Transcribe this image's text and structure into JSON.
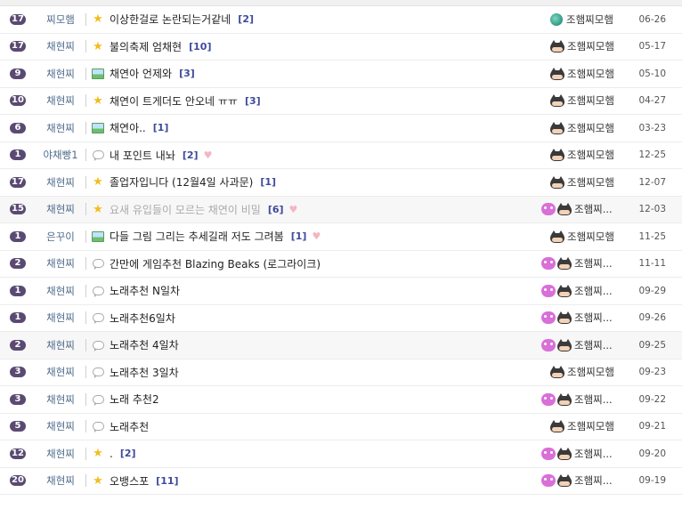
{
  "rows": [
    {
      "comments": "17",
      "category": "찌모햄",
      "icon": "star-icon",
      "title": "이상한걸로 논란되는거같네",
      "count": "[2]",
      "heart": false,
      "muted": false,
      "avatars": [
        "globe-avatar-icon"
      ],
      "author": "조햄찌모햄",
      "date": "06-26"
    },
    {
      "comments": "17",
      "category": "채현찌",
      "icon": "star-icon",
      "title": "불의축제 엄채현",
      "count": "[10]",
      "heart": false,
      "muted": false,
      "avatars": [
        "cat-avatar-icon"
      ],
      "author": "조햄찌모햄",
      "date": "05-17"
    },
    {
      "comments": "9",
      "category": "채현찌",
      "icon": "image-icon",
      "title": "채연아 언제와",
      "count": "[3]",
      "heart": false,
      "muted": false,
      "avatars": [
        "cat-avatar-icon"
      ],
      "author": "조햄찌모햄",
      "date": "05-10"
    },
    {
      "comments": "10",
      "category": "채현찌",
      "icon": "star-icon",
      "title": "채연이 트게더도 안오네 ㅠㅠ",
      "count": "[3]",
      "heart": false,
      "muted": false,
      "avatars": [
        "cat-avatar-icon"
      ],
      "author": "조햄찌모햄",
      "date": "04-27"
    },
    {
      "comments": "6",
      "category": "채현찌",
      "icon": "image-icon",
      "title": "채연아..",
      "count": "[1]",
      "heart": false,
      "muted": false,
      "avatars": [
        "cat-avatar-icon"
      ],
      "author": "조햄찌모햄",
      "date": "03-23"
    },
    {
      "comments": "1",
      "category": "야채빵1",
      "icon": "speech-bubble-icon",
      "title": "내 포인트 내놔",
      "count": "[2]",
      "heart": true,
      "muted": false,
      "avatars": [
        "cat-avatar-icon"
      ],
      "author": "조햄찌모햄",
      "date": "12-25"
    },
    {
      "comments": "17",
      "category": "채현찌",
      "icon": "star-icon",
      "title": "졸업자입니다 (12월4일 사과문)",
      "count": "[1]",
      "heart": false,
      "muted": false,
      "avatars": [
        "cat-avatar-icon"
      ],
      "author": "조햄찌모햄",
      "date": "12-07"
    },
    {
      "comments": "15",
      "category": "채현찌",
      "icon": "star-icon",
      "title": "요새 유입들이 모르는 채연이 비밀",
      "count": "[6]",
      "heart": true,
      "muted": true,
      "avatars": [
        "pink-avatar-icon",
        "cat-avatar-icon"
      ],
      "author": "조햄찌...",
      "date": "12-03"
    },
    {
      "comments": "1",
      "category": "은꾸이",
      "icon": "image-icon",
      "title": "다들 그림 그리는 추세길래 저도 그려봄",
      "count": "[1]",
      "heart": true,
      "muted": false,
      "avatars": [
        "cat-avatar-icon"
      ],
      "author": "조햄찌모햄",
      "date": "11-25"
    },
    {
      "comments": "2",
      "category": "채현찌",
      "icon": "speech-bubble-icon",
      "title": "간만에 게임추천 Blazing Beaks (로그라이크)",
      "count": "",
      "heart": false,
      "muted": false,
      "avatars": [
        "pink-avatar-icon",
        "cat-avatar-icon"
      ],
      "author": "조햄찌...",
      "date": "11-11"
    },
    {
      "comments": "1",
      "category": "채현찌",
      "icon": "speech-bubble-icon",
      "title": "노래추천 N일차",
      "count": "",
      "heart": false,
      "muted": false,
      "avatars": [
        "pink-avatar-icon",
        "cat-avatar-icon"
      ],
      "author": "조햄찌...",
      "date": "09-29"
    },
    {
      "comments": "1",
      "category": "채현찌",
      "icon": "speech-bubble-icon",
      "title": "노래추천6일차",
      "count": "",
      "heart": false,
      "muted": false,
      "avatars": [
        "pink-avatar-icon",
        "cat-avatar-icon"
      ],
      "author": "조햄찌...",
      "date": "09-26"
    },
    {
      "comments": "2",
      "category": "채현찌",
      "icon": "speech-bubble-icon",
      "title": "노래추천 4일차",
      "count": "",
      "heart": false,
      "muted": false,
      "avatars": [
        "pink-avatar-icon",
        "cat-avatar-icon"
      ],
      "author": "조햄찌...",
      "date": "09-25"
    },
    {
      "comments": "3",
      "category": "채현찌",
      "icon": "speech-bubble-icon",
      "title": "노래추천 3일차",
      "count": "",
      "heart": false,
      "muted": false,
      "avatars": [
        "cat-avatar-icon"
      ],
      "author": "조햄찌모햄",
      "date": "09-23"
    },
    {
      "comments": "3",
      "category": "채현찌",
      "icon": "speech-bubble-icon",
      "title": "노래 추천2",
      "count": "",
      "heart": false,
      "muted": false,
      "avatars": [
        "pink-avatar-icon",
        "cat-avatar-icon"
      ],
      "author": "조햄찌...",
      "date": "09-22"
    },
    {
      "comments": "5",
      "category": "채현찌",
      "icon": "speech-bubble-icon",
      "title": "노래추천",
      "count": "",
      "heart": false,
      "muted": false,
      "avatars": [
        "cat-avatar-icon"
      ],
      "author": "조햄찌모햄",
      "date": "09-21"
    },
    {
      "comments": "12",
      "category": "채현찌",
      "icon": "star-icon",
      "title": ".",
      "count": "[2]",
      "heart": false,
      "muted": false,
      "avatars": [
        "pink-avatar-icon",
        "cat-avatar-icon"
      ],
      "author": "조햄찌...",
      "date": "09-20"
    },
    {
      "comments": "20",
      "category": "채현찌",
      "icon": "star-icon",
      "title": "오뱅스포",
      "count": "[11]",
      "heart": false,
      "muted": false,
      "avatars": [
        "pink-avatar-icon",
        "cat-avatar-icon"
      ],
      "author": "조햄찌...",
      "date": "09-19"
    }
  ],
  "colors": {
    "badge": "#5a4a72",
    "category": "#4f6b8a",
    "count": "#3d4a9c",
    "star": "#f2bd1d",
    "heart": "#f4b6c2"
  }
}
